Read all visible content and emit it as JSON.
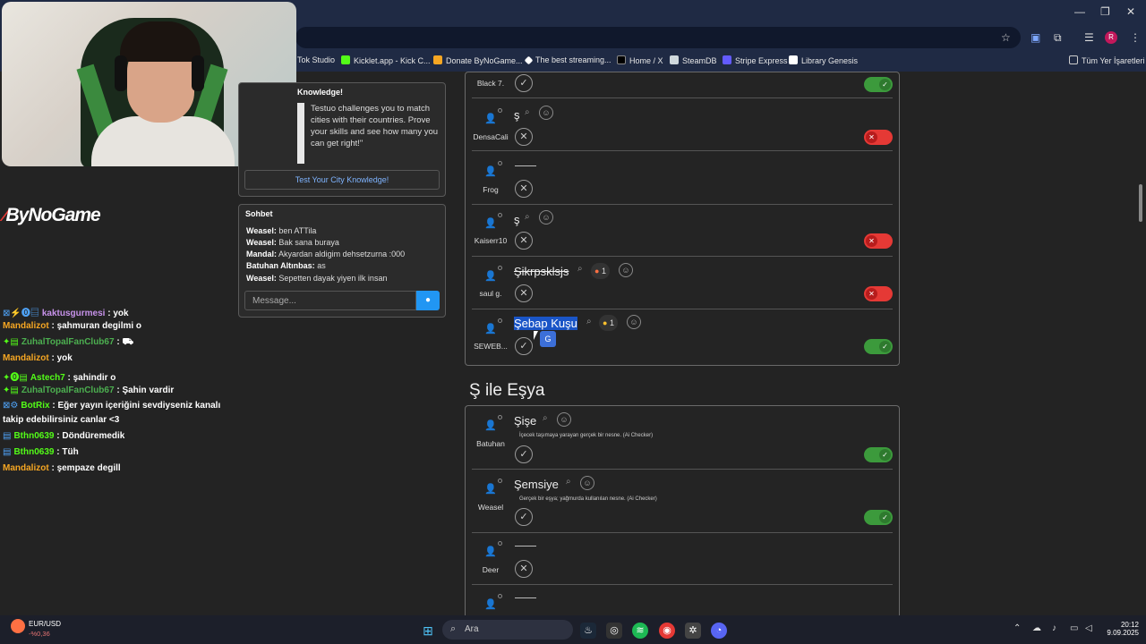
{
  "browser": {
    "bookmarks": [
      {
        "label": "Tok Studio",
        "color": "#000000"
      },
      {
        "label": "Kicklet.app - Kick C...",
        "color": "#53fc18"
      },
      {
        "label": "Donate ByNoGame...",
        "color": "#f5a623"
      },
      {
        "label": "The best streaming...",
        "color": "#ffffff"
      },
      {
        "label": "Home / X",
        "color": "#000000"
      },
      {
        "label": "SteamDB",
        "color": "#1b2838"
      },
      {
        "label": "Stripe Express",
        "color": "#635bff"
      },
      {
        "label": "Library Genesis",
        "color": "#ffffff"
      },
      {
        "label": "Tüm Yer İşaretleri",
        "color": "#cccccc"
      }
    ],
    "profile_initial": "R"
  },
  "overlay": {
    "logo": "ByNoGame",
    "chat": [
      {
        "user": "kaktusgurmesi",
        "color": "#c792ea",
        "msg": "yok"
      },
      {
        "user": "Mandalizot",
        "color": "#f5a623",
        "msg": "şahmuran degilmi o"
      },
      {
        "user": "ZuhalTopalFanClub67",
        "color": "#4caf50",
        "msg": ""
      },
      {
        "user": "Mandalizot",
        "color": "#f5a623",
        "msg": "yok"
      },
      {
        "user": "Astech7",
        "color": "#53fc18",
        "msg": "şahindir o"
      },
      {
        "user": "ZuhalTopalFanClub67",
        "color": "#4caf50",
        "msg": "Şahin vardir"
      },
      {
        "user": "BotRix",
        "color": "#53fc18",
        "msg": "Eğer yayın içeriğini sevdiyseniz kanalı"
      },
      {
        "user": "",
        "color": "#ffffff",
        "msg": "takip edebilirsiniz canlar <3"
      },
      {
        "user": "Bthn0639",
        "color": "#53fc18",
        "msg": "Döndüremedik"
      },
      {
        "user": "Bthn0639",
        "color": "#53fc18",
        "msg": "Tüh"
      },
      {
        "user": "Mandalizot",
        "color": "#f5a623",
        "msg": "şempaze degill"
      }
    ]
  },
  "knowledge": {
    "title": "Knowledge!",
    "text": "Testuo challenges you to match cities with their countries. Prove your skills and see how many you can get right!\"",
    "button": "Test Your City Knowledge!"
  },
  "sohbet": {
    "title": "Sohbet",
    "messages": [
      {
        "user": "Weasel:",
        "text": "ben ATTila"
      },
      {
        "user": "Weasel:",
        "text": "Bak sana buraya"
      },
      {
        "user": "Mandal:",
        "text": "Akyardan aldigim dehsetzurna :000"
      },
      {
        "user": "Batuhan Altınbas:",
        "text": "as"
      },
      {
        "user": "Weasel:",
        "text": "Sepetten dayak yiyen ilk insan"
      }
    ],
    "placeholder": "Message..."
  },
  "game": {
    "section_title": "Ş ile Eşya",
    "rows_a": [
      {
        "user": "Black 7.",
        "word": ""
      },
      {
        "user": "DensaCali",
        "word": "ş"
      },
      {
        "user": "Frog",
        "word": ""
      },
      {
        "user": "Kaiserr10",
        "word": "ş"
      },
      {
        "user": "saul g.",
        "word": "Şikrpsklsjs",
        "reaction": "1"
      },
      {
        "user": "SEWEB...",
        "word": "Şebap Kuşu",
        "reaction": "1"
      }
    ],
    "rows_b": [
      {
        "user": "Batuhan",
        "word": "Şişe",
        "desc": "İçecek taşımaya yarayan gerçek bir nesne. (Ai Checker)"
      },
      {
        "user": "Weasel",
        "word": "Şemsiye",
        "desc": "Gerçek bir eşya; yağmurda kullanılan nesne. (Ai Checker)"
      },
      {
        "user": "Deer",
        "word": ""
      }
    ]
  },
  "taskbar": {
    "fx_pair": "EUR/USD",
    "fx_change": "-%0,36",
    "search": "Ara",
    "time": "20:12",
    "date": "9.09.2025"
  }
}
